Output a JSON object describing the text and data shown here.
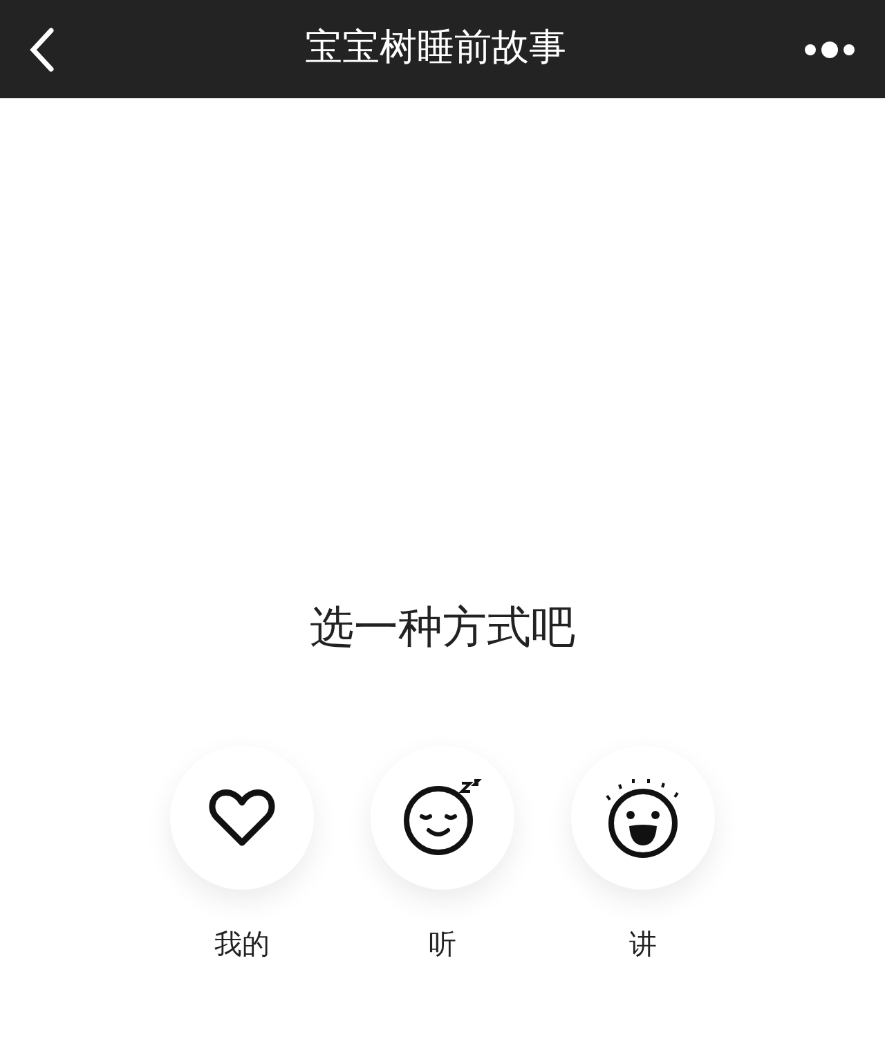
{
  "header": {
    "title": "宝宝树睡前故事"
  },
  "prompt": "选一种方式吧",
  "options": [
    {
      "kind": "heart",
      "label": "我的"
    },
    {
      "kind": "sleepy",
      "label": "听"
    },
    {
      "kind": "laugh",
      "label": "讲"
    }
  ]
}
